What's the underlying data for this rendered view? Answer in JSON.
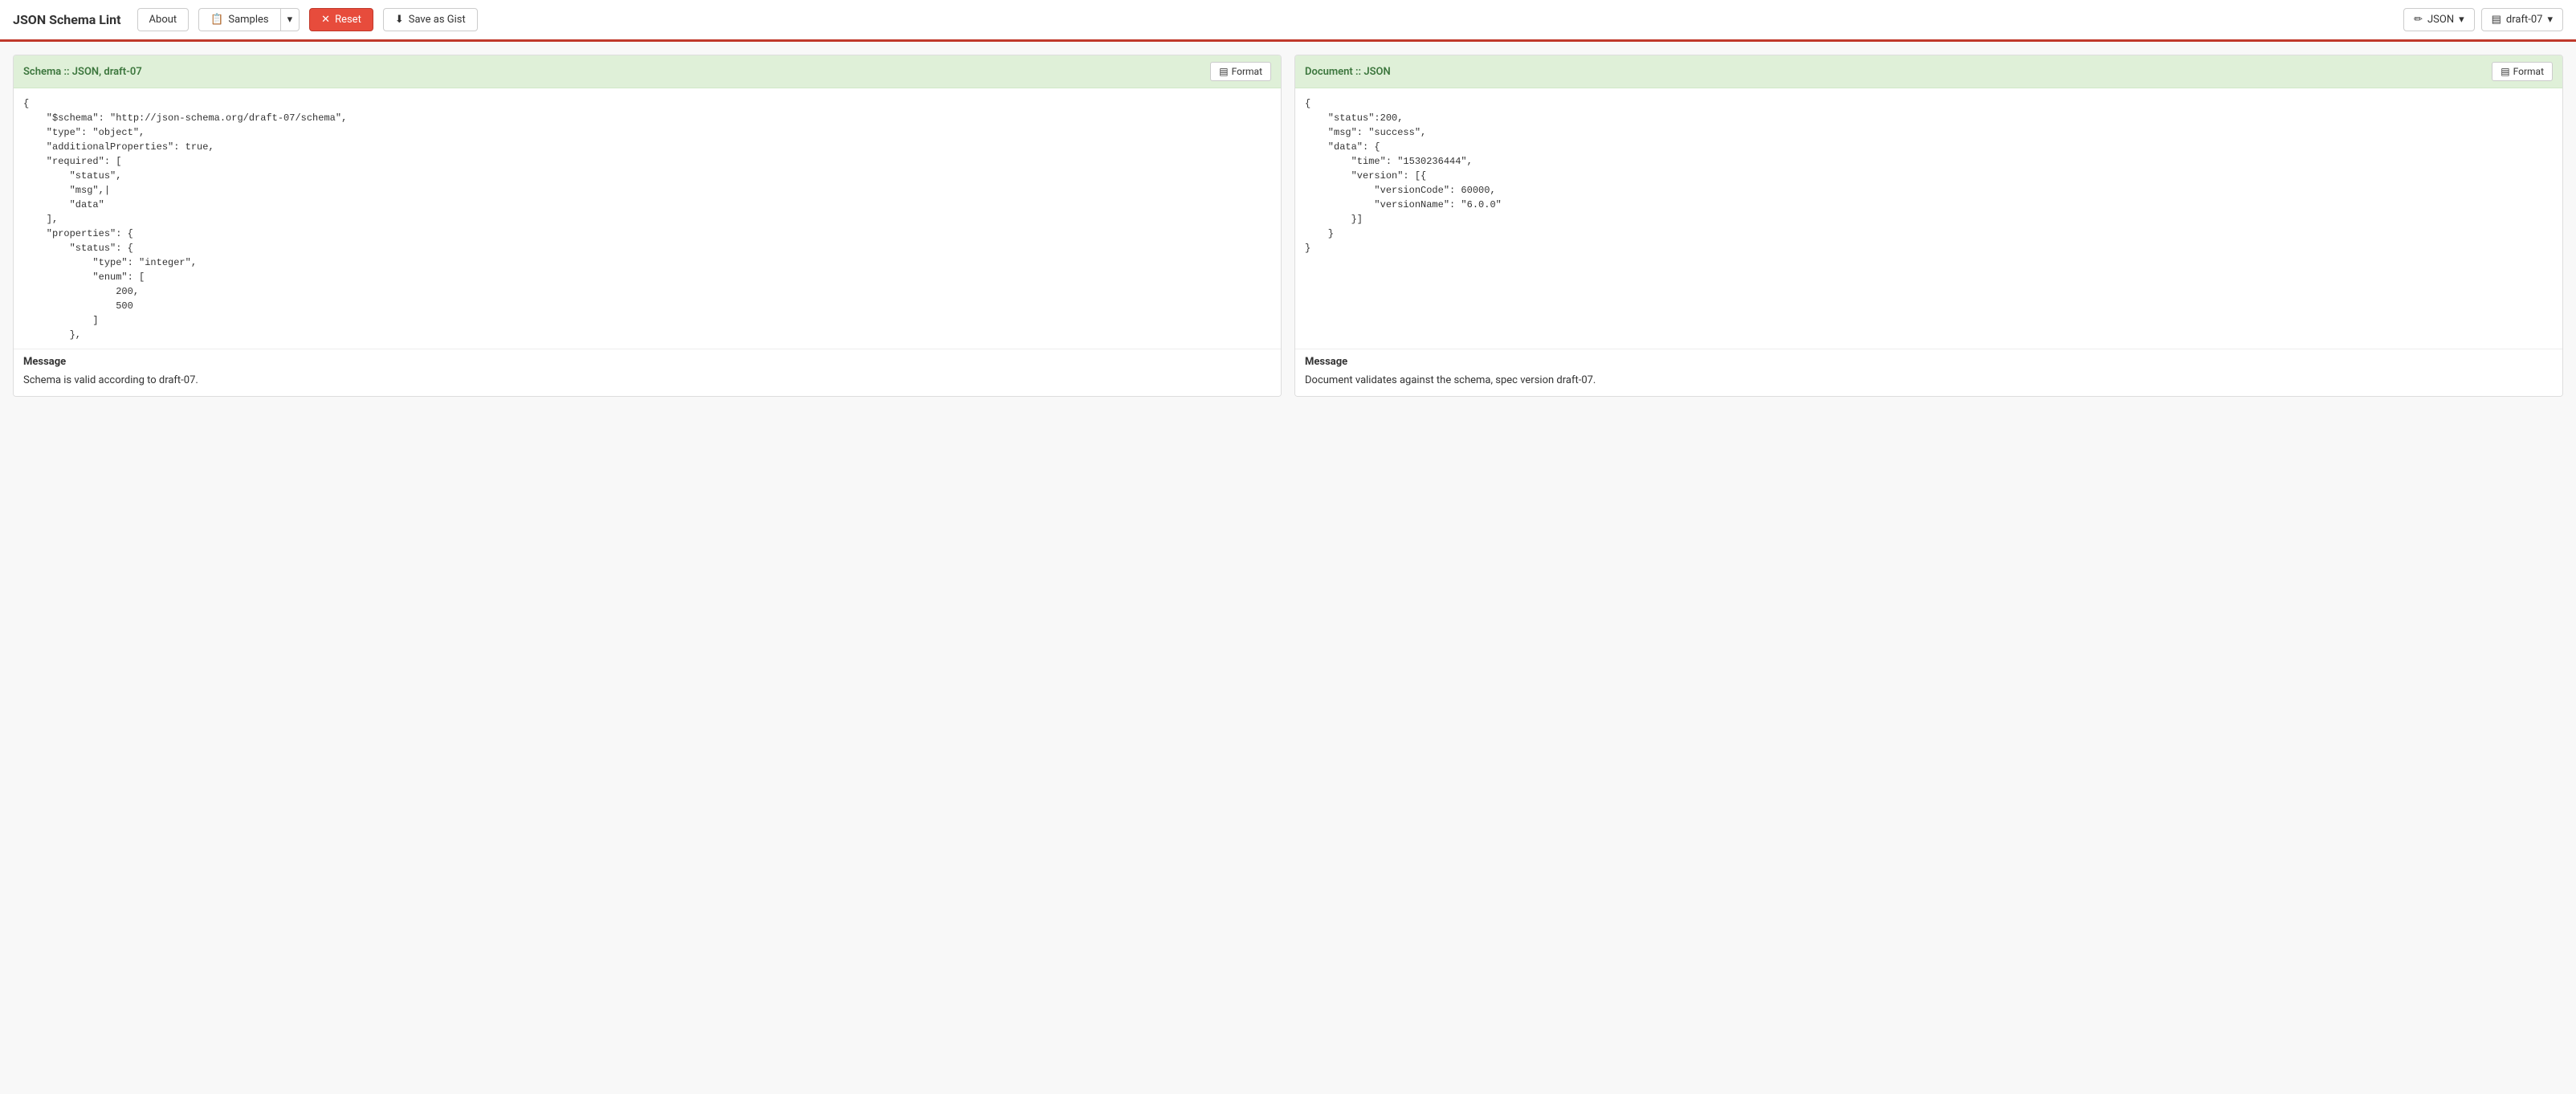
{
  "navbar": {
    "brand": "JSON Schema Lint",
    "about_label": "About",
    "samples_label": "Samples",
    "reset_label": "Reset",
    "save_gist_label": "Save as Gist",
    "json_dropdown_label": "JSON",
    "draft_dropdown_label": "draft-07"
  },
  "schema_panel": {
    "title": "Schema :: JSON, draft-07",
    "format_label": "Format",
    "code": "{\n    \"$schema\": \"http://json-schema.org/draft-07/schema\",\n    \"type\": \"object\",\n    \"additionalProperties\": true,\n    \"required\": [\n        \"status\",\n        \"msg\",|\n        \"data\"\n    ],\n    \"properties\": {\n        \"status\": {\n            \"type\": \"integer\",\n            \"enum\": [\n                200,\n                500\n            ]\n        },",
    "message_label": "Message",
    "message_text": "Schema is valid according to draft-07."
  },
  "document_panel": {
    "title": "Document :: JSON",
    "format_label": "Format",
    "code": "{\n    \"status\":200,\n    \"msg\": \"success\",\n    \"data\": {\n        \"time\": \"1530236444\",\n        \"version\": [{\n            \"versionCode\": 60000,\n            \"versionName\": \"6.0.0\"\n        }]\n    }\n}",
    "message_label": "Message",
    "message_text": "Document validates against the schema, spec version draft-07."
  },
  "icons": {
    "copy": "📋",
    "download": "⬇",
    "pencil": "✏",
    "columns": "▤",
    "caret": "▾"
  }
}
